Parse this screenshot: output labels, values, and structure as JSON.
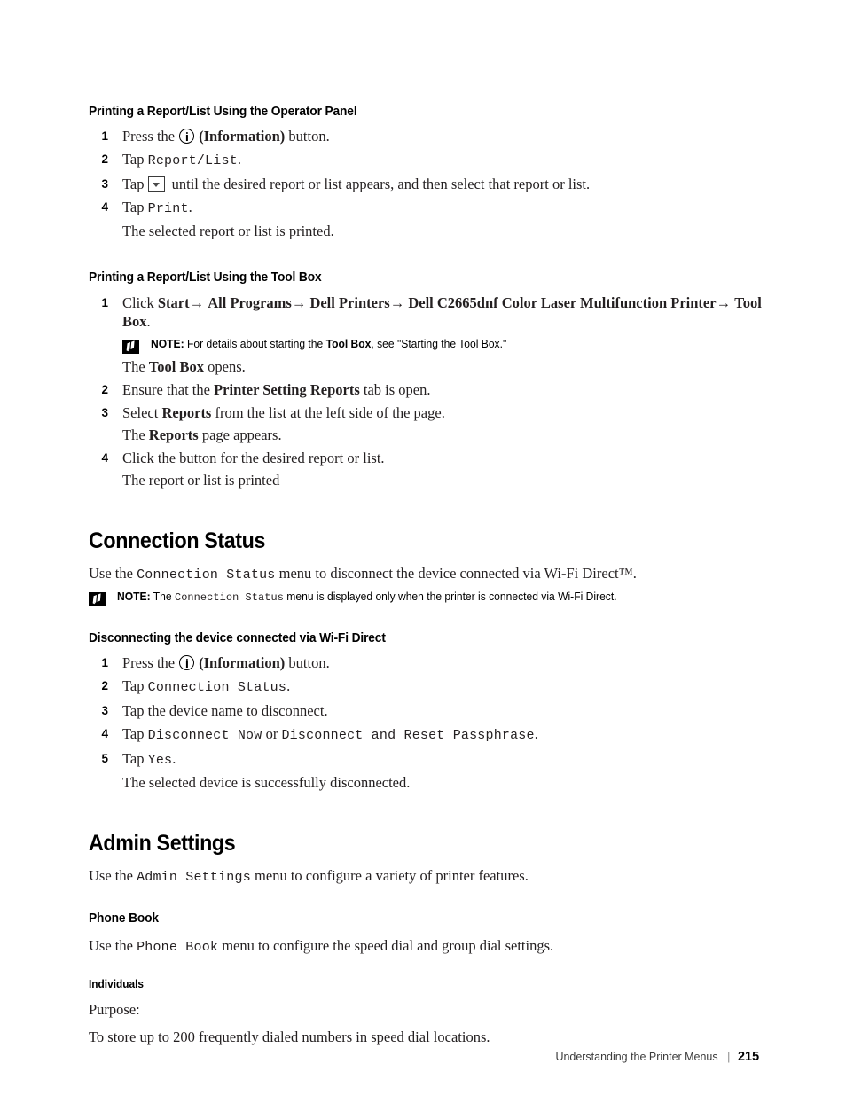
{
  "document": {
    "footer_title": "Understanding the Printer Menus",
    "footer_separator": "|",
    "page_number": "215"
  },
  "sections": {
    "operator_panel": {
      "heading": "Printing a Report/List Using the Operator Panel",
      "steps": [
        {
          "num": "1",
          "prefix": "Press the",
          "icon": "information-icon",
          "suffix_bold": "(Information)",
          "suffix": "button."
        },
        {
          "num": "2",
          "prefix": "Tap",
          "mono": "Report/List",
          "suffix": "."
        },
        {
          "num": "3",
          "prefix": "Tap",
          "icon": "dropdown-arrow-icon",
          "suffix": "until the desired report or list appears, and then select that report or list."
        },
        {
          "num": "4",
          "prefix": "Tap",
          "mono": "Print",
          "suffix": "."
        }
      ],
      "result": "The selected report or list is printed."
    },
    "tool_box": {
      "heading": "Printing a Report/List Using the Tool Box",
      "step1": {
        "num": "1",
        "text_start": "Click ",
        "path": [
          "Start",
          "All Programs",
          "Dell Printers",
          "Dell C2665dnf Color Laser Multifunction Printer",
          "Tool Box"
        ],
        "arrow": "→",
        "text_end": "."
      },
      "note": {
        "label": "NOTE:",
        "text_before": "For details about starting the ",
        "bold_term": "Tool Box",
        "text_after": ", see \"Starting the Tool Box.\""
      },
      "opens_text_before": "The ",
      "opens_bold": "Tool Box",
      "opens_text_after": " opens.",
      "steps": [
        {
          "num": "2",
          "text_before": "Ensure that the ",
          "bold": "Printer Setting Reports",
          "text_after": " tab is open."
        },
        {
          "num": "3",
          "text_before": "Select ",
          "bold": "Reports",
          "text_after": " from the list at the left side of the page."
        }
      ],
      "reports_result_before": "The ",
      "reports_result_bold": "Reports",
      "reports_result_after": " page appears.",
      "step4": {
        "num": "4",
        "text": "Click the button for the desired report or list."
      },
      "step4_result": "The report or list is printed"
    },
    "connection_status": {
      "heading": "Connection Status",
      "intro_before": "Use the ",
      "intro_mono": "Connection Status",
      "intro_after": " menu to disconnect the device connected via Wi-Fi Direct™.",
      "note": {
        "label": "NOTE:",
        "text_before": "The ",
        "mono": "Connection Status",
        "text_after": " menu is displayed only when the printer is connected via Wi-Fi Direct."
      },
      "subheading": "Disconnecting the device connected via Wi-Fi Direct",
      "steps": [
        {
          "num": "1",
          "prefix": "Press the",
          "icon": "information-icon",
          "suffix_bold": "(Information)",
          "suffix": "button."
        },
        {
          "num": "2",
          "prefix": "Tap",
          "mono": "Connection Status",
          "suffix": "."
        },
        {
          "num": "3",
          "text": "Tap the device name to disconnect."
        },
        {
          "num": "4",
          "prefix": "Tap",
          "mono": "Disconnect Now",
          "middle": "or",
          "mono2": "Disconnect and Reset Passphrase",
          "suffix": "."
        },
        {
          "num": "5",
          "prefix": "Tap",
          "mono": "Yes",
          "suffix": "."
        }
      ],
      "result": "The selected device is successfully disconnected."
    },
    "admin_settings": {
      "heading": "Admin Settings",
      "intro_before": "Use the ",
      "intro_mono": "Admin Settings",
      "intro_after": " menu to configure a variety of printer features.",
      "phone_book": {
        "heading": "Phone Book",
        "intro_before": "Use the ",
        "intro_mono": "Phone Book",
        "intro_after": " menu to configure the speed dial and group dial settings."
      },
      "individuals": {
        "heading": "Individuals",
        "purpose_label": "Purpose:",
        "purpose_text": "To store up to 200 frequently dialed numbers in speed dial locations."
      }
    }
  }
}
